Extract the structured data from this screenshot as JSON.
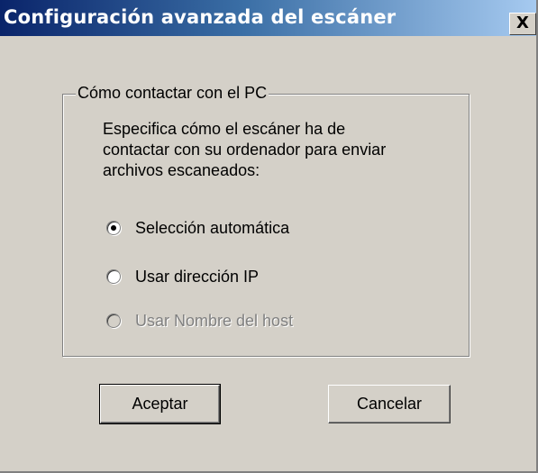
{
  "window": {
    "title": "Configuración avanzada del escáner",
    "close_label": "X"
  },
  "group": {
    "legend": "Cómo contactar con el PC",
    "description": "Especifica cómo el escáner ha de\ncontactar con su  ordenador para enviar\narchivos escaneados:"
  },
  "options": [
    {
      "label": "Selección automática",
      "checked": true,
      "enabled": true
    },
    {
      "label": "Usar dirección IP",
      "checked": false,
      "enabled": true
    },
    {
      "label": "Usar Nombre del host",
      "checked": false,
      "enabled": false
    }
  ],
  "buttons": {
    "accept": "Aceptar",
    "cancel": "Cancelar"
  }
}
